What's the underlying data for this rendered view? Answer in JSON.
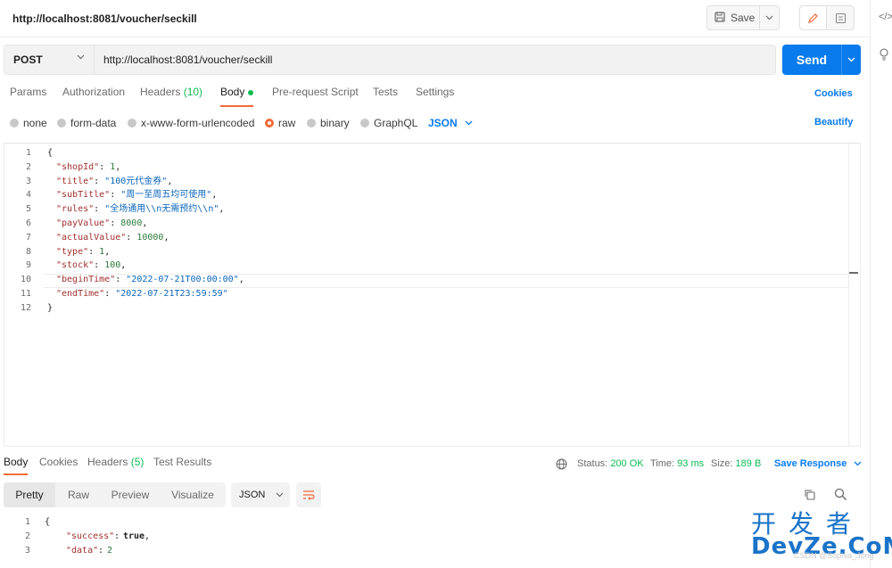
{
  "header": {
    "request_name": "http://localhost:8081/voucher/seckill",
    "save_label": "Save",
    "code_icon": "</>"
  },
  "request": {
    "method": "POST",
    "url": "http://localhost:8081/voucher/seckill",
    "send_label": "Send"
  },
  "tabs": {
    "params": "Params",
    "authorization": "Authorization",
    "headers": "Headers",
    "headers_count": "(10)",
    "body": "Body",
    "prerequest": "Pre-request Script",
    "tests": "Tests",
    "settings": "Settings",
    "cookies": "Cookies"
  },
  "body_types": {
    "none": "none",
    "form_data": "form-data",
    "urlencoded": "x-www-form-urlencoded",
    "raw": "raw",
    "binary": "binary",
    "graphql": "GraphQL",
    "selected": "raw",
    "language": "JSON",
    "beautify": "Beautify"
  },
  "editor": {
    "line_numbers": [
      "1",
      "2",
      "3",
      "4",
      "5",
      "6",
      "7",
      "8",
      "9",
      "10",
      "11",
      "12"
    ],
    "brace_open": "{",
    "brace_close": "}",
    "fields": [
      {
        "key": "\"shopId\"",
        "value": "1",
        "kind": "number",
        "comma": ","
      },
      {
        "key": "\"title\"",
        "value": "\"100元代金券\"",
        "kind": "string",
        "comma": ","
      },
      {
        "key": "\"subTitle\"",
        "value": "\"周一至周五均可使用\"",
        "kind": "string",
        "comma": ","
      },
      {
        "key": "\"rules\"",
        "value": "\"全场通用\\\\n无需预约\\\\n\"",
        "kind": "string",
        "comma": ","
      },
      {
        "key": "\"payValue\"",
        "value": "8000",
        "kind": "number",
        "comma": ","
      },
      {
        "key": "\"actualValue\"",
        "value": "10000",
        "kind": "number",
        "comma": ","
      },
      {
        "key": "\"type\"",
        "value": "1",
        "kind": "number",
        "comma": ","
      },
      {
        "key": "\"stock\"",
        "value": "100",
        "kind": "number",
        "comma": ","
      },
      {
        "key": "\"beginTime\"",
        "value": "\"2022-07-21T00:00:00\"",
        "kind": "string",
        "comma": ","
      },
      {
        "key": "\"endTime\"",
        "value": "\"2022-07-21T23:59:59\"",
        "kind": "string",
        "comma": ""
      }
    ]
  },
  "response": {
    "tabs": {
      "body": "Body",
      "cookies": "Cookies",
      "headers": "Headers",
      "headers_count": "(5)",
      "test_results": "Test Results"
    },
    "status_label": "Status:",
    "status_value": "200 OK",
    "time_label": "Time:",
    "time_value": "93 ms",
    "size_label": "Size:",
    "size_value": "189 B",
    "save_response": "Save Response",
    "view_modes": [
      "Pretty",
      "Raw",
      "Preview",
      "Visualize"
    ],
    "format": "JSON",
    "line_numbers": [
      "1",
      "2",
      "3"
    ],
    "brace_open": "{",
    "success_key": "\"success\"",
    "success_value": "true",
    "data_key": "\"data\"",
    "data_value": "2"
  },
  "watermark": {
    "line1": "开发者",
    "line2": "DevZe.CoM",
    "faint": "CSDN @Sophia_Jong"
  },
  "colors": {
    "accent_blue": "#097bed",
    "active_tab": "#f26b3a",
    "success_green": "#0cbb52"
  }
}
